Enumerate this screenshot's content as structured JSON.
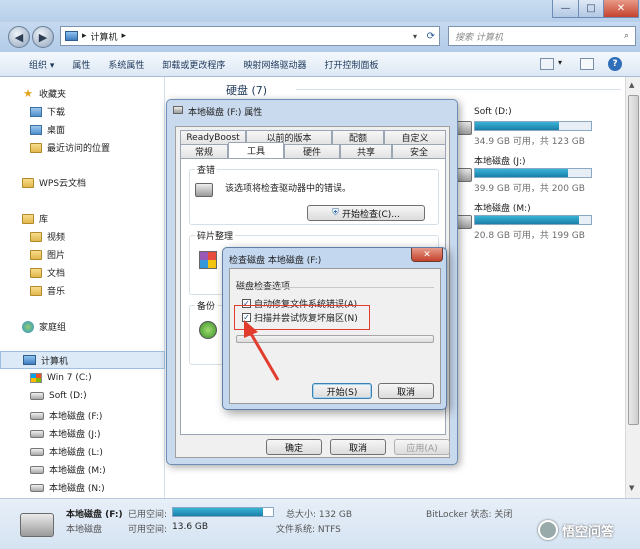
{
  "window": {
    "min": "—",
    "max": "□",
    "close": "✕"
  },
  "nav": {
    "back": "◀",
    "forward": "▶",
    "address": "计算机",
    "address_arrow": "▸",
    "search_placeholder": "搜索 计算机"
  },
  "toolbar": {
    "items": [
      "组织 ▾",
      "属性",
      "系统属性",
      "卸载或更改程序",
      "映射网络驱动器",
      "打开控制面板"
    ]
  },
  "sidebar": {
    "favorites": "收藏夹",
    "downloads": "下载",
    "desktop": "桌面",
    "recent": "最近访问的位置",
    "wps": "WPS云文档",
    "libraries": "库",
    "video": "视频",
    "pictures": "图片",
    "docs": "文档",
    "music": "音乐",
    "homegroup": "家庭组",
    "computer": "计算机",
    "win7": "Win 7 (C:)",
    "soft": "Soft (D:)",
    "f": "本地磁盘 (F:)",
    "j": "本地磁盘 (J:)",
    "l": "本地磁盘 (L:)",
    "m": "本地磁盘 (M:)",
    "n": "本地磁盘 (N:)"
  },
  "main": {
    "section": "硬盘 (7)",
    "drives": [
      {
        "name": "Soft (D:)",
        "free": "34.9 GB 可用，共 123 GB",
        "fill": 0.72
      },
      {
        "name": "本地磁盘 (J:)",
        "free": "39.9 GB 可用，共 200 GB",
        "fill": 0.8
      },
      {
        "name": "本地磁盘 (M:)",
        "free": "20.8 GB 可用，共 199 GB",
        "fill": 0.9
      }
    ]
  },
  "status": {
    "drive": "本地磁盘 (F:)",
    "used_label": "已用空间:",
    "free_label": "可用空间:",
    "free_val": "13.6 GB",
    "type": "本地磁盘",
    "total_label": "总大小: 132 GB",
    "fs_label": "文件系统: NTFS",
    "bitlocker": "BitLocker 状态: 关闭",
    "used_fill": 0.9
  },
  "props": {
    "title": "本地磁盘 (F:) 属性",
    "tabs_row1": [
      "ReadyBoost",
      "以前的版本",
      "配额",
      "自定义"
    ],
    "tabs_row2": [
      "常规",
      "工具",
      "硬件",
      "共享",
      "安全"
    ],
    "check_group": "查错",
    "check_text": "该选项将检查驱动器中的错误。",
    "check_btn": "开始检查(C)...",
    "defrag_group": "碎片整理",
    "backup_group": "备份",
    "ok": "确定",
    "cancel": "取消",
    "apply": "应用(A)"
  },
  "chkdsk": {
    "title": "检查磁盘 本地磁盘 (F:)",
    "close": "✕",
    "options_label": "磁盘检查选项",
    "opt1": "自动修复文件系统错误(A)",
    "opt2": "扫描并尝试恢复坏扇区(N)",
    "opt1_check": "✓",
    "opt2_check": "✓",
    "start": "开始(S)",
    "cancel": "取消"
  },
  "watermark": "悟空问答"
}
